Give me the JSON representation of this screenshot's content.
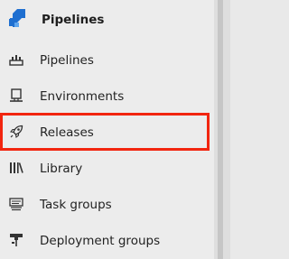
{
  "header": {
    "title": "Pipelines",
    "icon": "pipelines-logo-icon",
    "accent_color": "#1f6fd0"
  },
  "nav": {
    "items": [
      {
        "label": "Pipelines",
        "icon": "pipeline-icon"
      },
      {
        "label": "Environments",
        "icon": "environment-icon"
      },
      {
        "label": "Releases",
        "icon": "rocket-icon"
      },
      {
        "label": "Library",
        "icon": "library-icon"
      },
      {
        "label": "Task groups",
        "icon": "task-groups-icon"
      },
      {
        "label": "Deployment groups",
        "icon": "deployment-groups-icon"
      }
    ]
  },
  "highlight": {
    "target": "Releases",
    "color": "#f2250f"
  }
}
